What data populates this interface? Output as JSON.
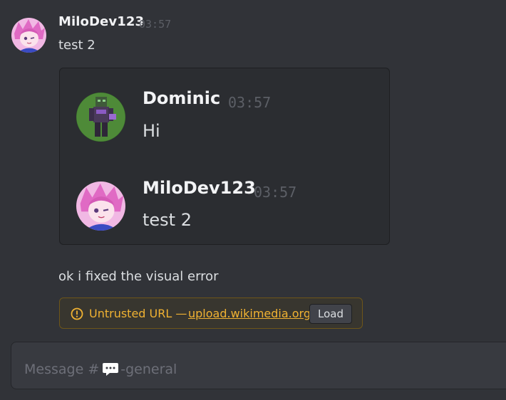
{
  "messages": [
    {
      "author": "MiloDev123",
      "timestamp": "03:57",
      "text": "test 2"
    }
  ],
  "embed": {
    "items": [
      {
        "author": "Dominic",
        "timestamp": "03:57",
        "text": "Hi"
      },
      {
        "author": "MiloDev123",
        "timestamp": "03:57",
        "text": "test 2"
      }
    ]
  },
  "followup": {
    "text": "ok i fixed the visual error"
  },
  "warning": {
    "label": "Untrusted URL",
    "separator": "—",
    "link": "upload.wikimedia.org",
    "button": "Load",
    "color": "#f0b232"
  },
  "composer": {
    "placeholder_prefix": "Message #",
    "placeholder_suffix": "-general",
    "channel_icon": "speech-bubble-icon"
  }
}
